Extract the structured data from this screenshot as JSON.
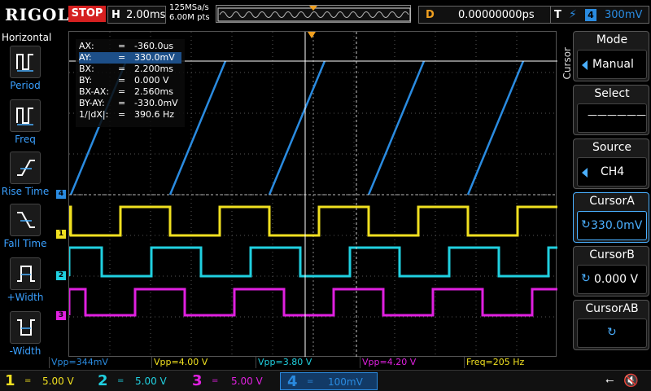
{
  "brand": "RIGOL",
  "status": "STOP",
  "timebase": {
    "prefix": "H",
    "value": "2.00ms"
  },
  "acquisition": {
    "sample_rate": "125MSa/s",
    "memory_depth": "6.00M pts"
  },
  "trigger_delay": {
    "label": "D",
    "value": "0.00000000ps"
  },
  "trigger": {
    "label": "T",
    "source": "4",
    "level": "300mV",
    "edge_icon": "rising-edge-icon"
  },
  "left_menu": {
    "title": "Horizontal",
    "items": [
      {
        "label": "Period",
        "icon": "period-icon"
      },
      {
        "label": "Freq",
        "icon": "freq-icon"
      },
      {
        "label": "Rise Time",
        "icon": "rise-time-icon"
      },
      {
        "label": "Fall Time",
        "icon": "fall-time-icon"
      },
      {
        "label": "+Width",
        "icon": "pos-width-icon"
      },
      {
        "label": "-Width",
        "icon": "neg-width-icon"
      }
    ]
  },
  "cursor_info": [
    {
      "name": "AX:",
      "value": "-360.0us"
    },
    {
      "name": "AY:",
      "value": "330.0mV"
    },
    {
      "name": "BX:",
      "value": "2.200ms"
    },
    {
      "name": "BY:",
      "value": "0.000 V"
    },
    {
      "name": "BX-AX:",
      "value": "2.560ms"
    },
    {
      "name": "BY-AY:",
      "value": "-330.0mV"
    },
    {
      "name": "1/|dX|:",
      "value": "390.6 Hz"
    }
  ],
  "channel_markers": [
    "4",
    "1",
    "2",
    "3"
  ],
  "measurements": [
    {
      "text": "Vpp=344mV",
      "color": "#2a8be0"
    },
    {
      "text": "Vpp=4.00 V",
      "color": "#f0e020"
    },
    {
      "text": "Vpp=3.80 V",
      "color": "#20d0e0"
    },
    {
      "text": "Vpp=4.20 V",
      "color": "#e020e0"
    },
    {
      "text": "Freq=205 Hz",
      "color": "#f0e020"
    }
  ],
  "channels": [
    {
      "num": "1",
      "coupling": "=",
      "scale": "5.00 V",
      "color": "#f0e020"
    },
    {
      "num": "2",
      "coupling": "=",
      "scale": "5.00 V",
      "color": "#20d0e0"
    },
    {
      "num": "3",
      "coupling": "=",
      "scale": "5.00 V",
      "color": "#e020e0"
    },
    {
      "num": "4",
      "coupling": "=",
      "scale": "100mV",
      "color": "#2a8be0"
    }
  ],
  "right_menu": {
    "title": "Cursor",
    "items": [
      {
        "label": "Mode",
        "value": "Manual"
      },
      {
        "label": "Select",
        "value": "——————"
      },
      {
        "label": "Source",
        "value": "CH4"
      },
      {
        "label": "CursorA",
        "value": "330.0mV"
      },
      {
        "label": "CursorB",
        "value": "0.000 V"
      },
      {
        "label": "CursorAB",
        "value": ""
      }
    ]
  },
  "colors": {
    "ch1": "#f0e020",
    "ch2": "#20d0e0",
    "ch3": "#e020e0",
    "ch4": "#2a8be0",
    "trigger": "#f0a020",
    "stop": "#d52020"
  }
}
